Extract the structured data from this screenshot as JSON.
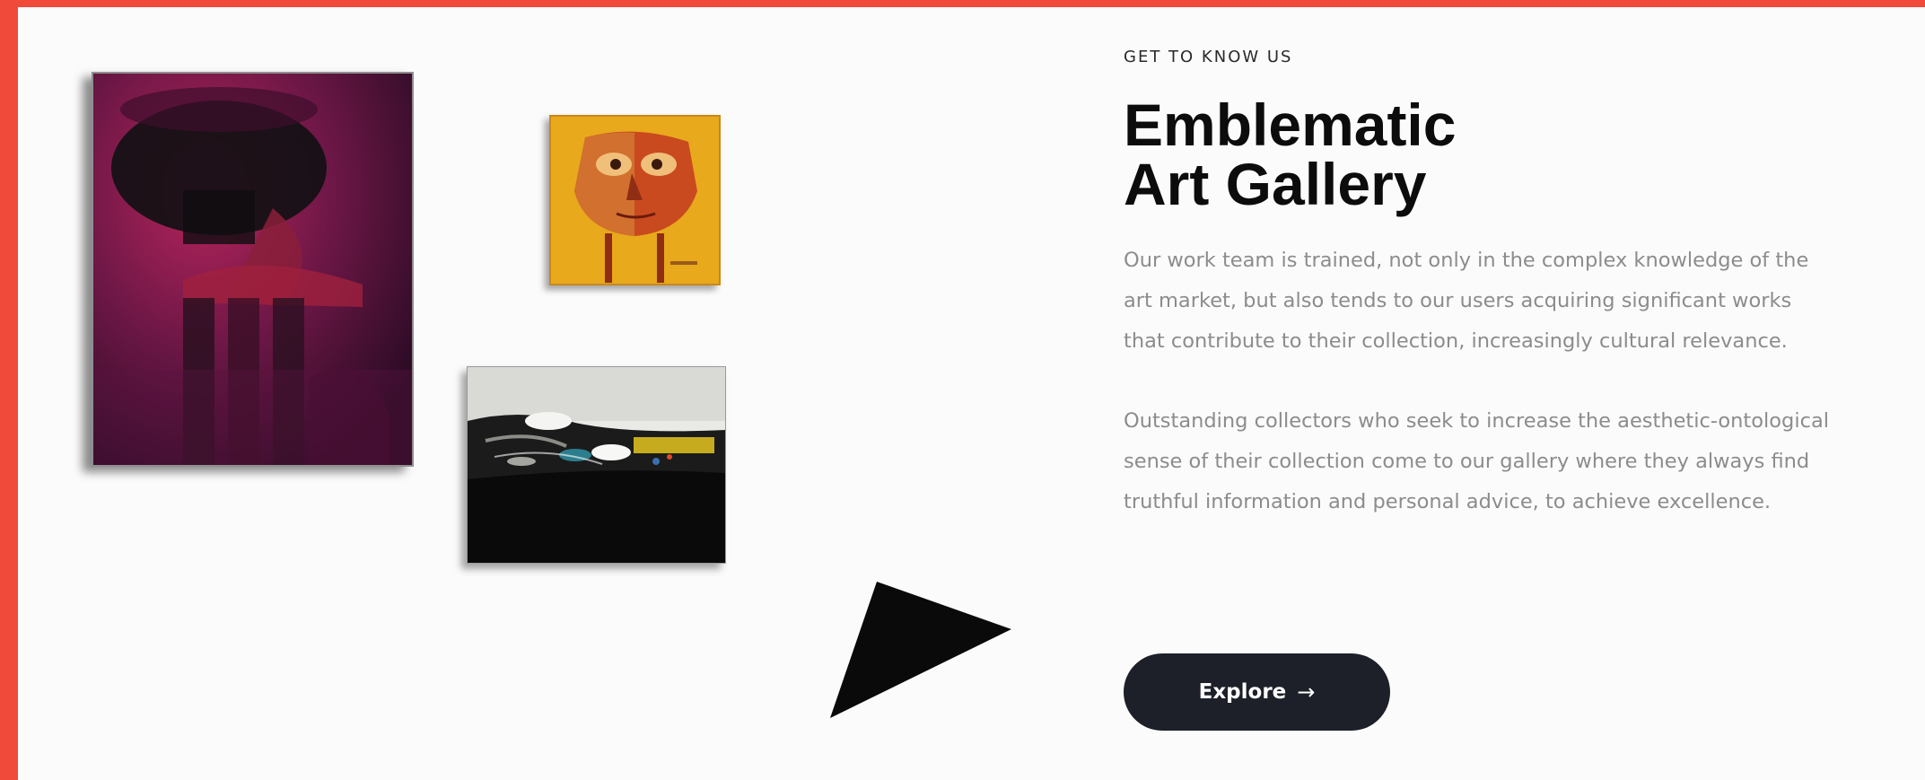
{
  "colors": {
    "frame": "#f04a3a",
    "background": "#fbfbfb",
    "heading": "#0c0c0c",
    "body_text": "#8c8c8c",
    "button_bg": "#1d2028",
    "button_text": "#ffffff"
  },
  "section": {
    "eyebrow": "GET TO KNOW US",
    "title_line_1": "Emblematic",
    "title_line_2": "Art Gallery",
    "paragraphs": [
      "Our work team is trained, not only in the complex knowledge of the art market, but also tends to our users acquiring significant works that contribute to their collection, increasingly cultural relevance.",
      "Outstanding collectors who seek to increase the aesthetic-ontological sense of their collection come to our gallery where they always find truthful information and personal advice, to achieve excellence."
    ],
    "button": {
      "label": "Explore",
      "icon": "arrow-right-icon",
      "icon_glyph": "→"
    }
  },
  "gallery": {
    "artworks": [
      {
        "name": "purple-abstract-figure-painting"
      },
      {
        "name": "yellow-face-painting"
      },
      {
        "name": "black-white-abstract-landscape-painting"
      }
    ],
    "decoration": "black-triangle-arrow-icon"
  }
}
